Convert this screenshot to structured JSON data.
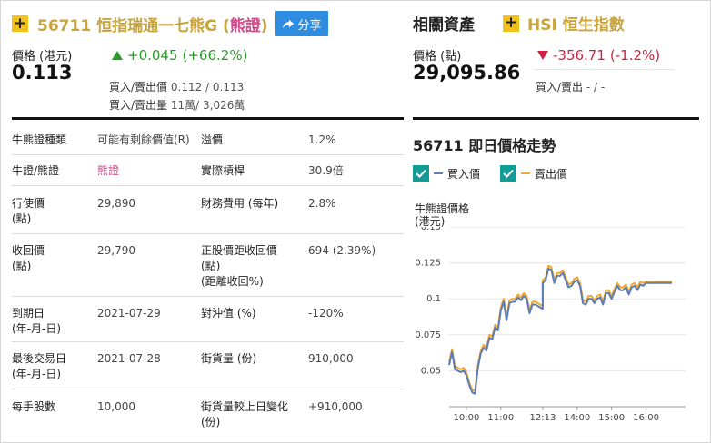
{
  "warrant": {
    "code": "56711",
    "name_prefix": "恒指瑞通一七熊G",
    "kind_open": " (",
    "kind": "熊證",
    "kind_close": ")",
    "share_label": "分享",
    "price_label": "價格 (港元)",
    "price": "0.113",
    "change": "+0.045",
    "change_pct": "(+66.2%)",
    "bidask_label": "買入/賣出價",
    "bidask_value": "0.112 / 0.113",
    "volume_label": "買入/賣出量",
    "volume_value": "11萬/ 3,026萬"
  },
  "details": [
    {
      "k1": "牛熊證種類",
      "v1": "可能有剩餘價值(R)",
      "k2": "溢價",
      "v2": "1.2%"
    },
    {
      "k1": "牛證/熊證",
      "v1": "熊證",
      "k2": "實際槓桿",
      "v2": "30.9倍"
    },
    {
      "k1": "行使價",
      "k1b": "(點)",
      "v1": "29,890",
      "k2": "財務費用 (每年)",
      "v2": "2.8%"
    },
    {
      "k1": "收回價",
      "k1b": "(點)",
      "v1": "29,790",
      "k2": "正股價距收回價",
      "k2b": "(點)",
      "k2c": "(距離收回%)",
      "v2": "694 (2.39%)"
    },
    {
      "k1": "到期日",
      "k1b": "(年-月-日)",
      "v1": "2021-07-29",
      "k2": "對沖值 (%)",
      "v2": "-120%"
    },
    {
      "k1": "最後交易日",
      "k1b": "(年-月-日)",
      "v1": "2021-07-28",
      "k2": "街貨量 (份)",
      "v2": "910,000"
    },
    {
      "k1": "每手股數",
      "v1": "10,000",
      "k2": "街貨量較上日變化",
      "k2b": "(份)",
      "v2": "+910,000"
    }
  ],
  "hsi": {
    "section_title": "相關資產",
    "code": "HSI",
    "name": "恒生指數",
    "price_label": "價格 (點)",
    "price": "29,095.86",
    "change": "-356.71",
    "change_pct": "(-1.2%)",
    "bidask_label": "買入/賣出",
    "bidask_value": "- / -"
  },
  "chart": {
    "title": "56711 即日價格走勢",
    "legend_bid": "買入價",
    "legend_ask": "賣出價",
    "ylabel_line1": "牛熊證價格",
    "ylabel_line2": "(港元)"
  },
  "colors": {
    "accent_gold": "#c8a43c",
    "plus_box": "#f2c21a",
    "up_green": "#2a9a2a",
    "down_red": "#d0213e",
    "bear_pink": "#d04a8a",
    "share_blue": "#2e8de0",
    "checkbox_teal": "#139c95",
    "bid_line": "#5b7db8",
    "ask_line": "#f0a830"
  },
  "chart_data": {
    "type": "line",
    "xlabel": "",
    "ylabel": "牛熊證價格 (港元)",
    "ylim": [
      0.025,
      0.15
    ],
    "yticks": [
      0.15,
      0.125,
      0.1,
      0.075,
      0.05
    ],
    "ytick_labels": [
      "0.15",
      "0.125",
      "0.1",
      "0.075",
      "0.05"
    ],
    "xticks": [
      "10:00",
      "11:00",
      "12:13",
      "14:00",
      "15:00",
      "16:00"
    ],
    "x": [
      "09:30",
      "09:35",
      "09:40",
      "09:45",
      "09:50",
      "09:55",
      "10:00",
      "10:05",
      "10:10",
      "10:15",
      "10:20",
      "10:25",
      "10:30",
      "10:35",
      "10:40",
      "10:45",
      "10:50",
      "10:55",
      "11:00",
      "11:05",
      "11:10",
      "11:15",
      "11:20",
      "11:25",
      "11:30",
      "11:35",
      "11:40",
      "11:45",
      "11:50",
      "11:55",
      "12:00",
      "12:13",
      "13:00",
      "13:05",
      "13:10",
      "13:15",
      "13:20",
      "13:25",
      "13:30",
      "13:35",
      "13:40",
      "13:45",
      "13:50",
      "13:55",
      "14:00",
      "14:05",
      "14:10",
      "14:15",
      "14:20",
      "14:25",
      "14:30",
      "14:35",
      "14:40",
      "14:45",
      "14:50",
      "14:55",
      "15:00",
      "15:05",
      "15:10",
      "15:15",
      "15:20",
      "15:25",
      "15:30",
      "15:35",
      "15:40",
      "15:45",
      "15:50",
      "15:55",
      "16:00",
      "16:05",
      "16:10",
      "16:15",
      "16:20",
      "16:25",
      "16:30",
      "16:35",
      "16:40",
      "16:45"
    ],
    "series": [
      {
        "name": "買入價",
        "values": [
          0.054,
          0.063,
          0.051,
          0.05,
          0.049,
          0.05,
          0.047,
          0.04,
          0.035,
          0.034,
          0.052,
          0.062,
          0.066,
          0.064,
          0.073,
          0.072,
          0.08,
          0.078,
          0.092,
          0.098,
          0.085,
          0.097,
          0.098,
          0.098,
          0.101,
          0.099,
          0.102,
          0.1,
          0.09,
          0.096,
          0.096,
          0.093,
          0.111,
          0.113,
          0.121,
          0.12,
          0.111,
          0.116,
          0.116,
          0.118,
          0.113,
          0.108,
          0.109,
          0.112,
          0.113,
          0.109,
          0.097,
          0.096,
          0.1,
          0.1,
          0.097,
          0.1,
          0.101,
          0.096,
          0.104,
          0.104,
          0.1,
          0.105,
          0.109,
          0.106,
          0.106,
          0.108,
          0.103,
          0.108,
          0.109,
          0.106,
          0.11,
          0.109,
          0.111,
          0.111,
          0.111,
          0.111,
          0.111,
          0.111,
          0.111,
          0.111,
          0.111,
          0.111
        ]
      },
      {
        "name": "賣出價",
        "values": [
          0.056,
          0.065,
          0.053,
          0.052,
          0.051,
          0.052,
          0.049,
          0.042,
          0.037,
          0.036,
          0.054,
          0.064,
          0.068,
          0.066,
          0.075,
          0.074,
          0.082,
          0.08,
          0.094,
          0.1,
          0.087,
          0.099,
          0.1,
          0.1,
          0.103,
          0.101,
          0.104,
          0.102,
          0.092,
          0.098,
          0.098,
          0.095,
          0.113,
          0.115,
          0.123,
          0.122,
          0.113,
          0.118,
          0.118,
          0.12,
          0.115,
          0.11,
          0.111,
          0.114,
          0.115,
          0.111,
          0.099,
          0.098,
          0.102,
          0.102,
          0.099,
          0.102,
          0.103,
          0.098,
          0.106,
          0.106,
          0.102,
          0.107,
          0.111,
          0.108,
          0.108,
          0.11,
          0.105,
          0.11,
          0.111,
          0.108,
          0.112,
          0.111,
          0.112,
          0.112,
          0.112,
          0.112,
          0.112,
          0.112,
          0.112,
          0.112,
          0.112,
          0.112
        ]
      }
    ]
  }
}
